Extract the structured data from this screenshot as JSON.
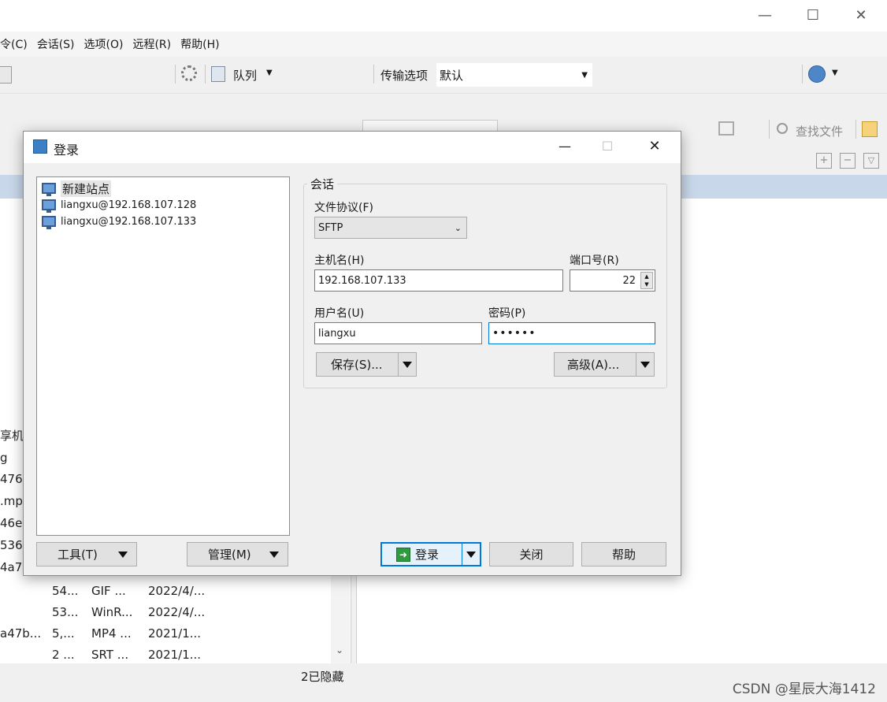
{
  "main": {
    "menu": [
      "令(C)",
      "会话(S)",
      "选项(O)",
      "远程(R)",
      "帮助(H)"
    ],
    "toolbar": {
      "queue_label": "队列",
      "transfer_label": "传输选项",
      "transfer_value": "默认"
    },
    "right_toolbar": {
      "find_files_label": "查找文件"
    },
    "left_cut_texts": [
      "享机",
      "g",
      "476",
      ".mp",
      "46e",
      "536",
      "4a7"
    ],
    "files": [
      {
        "name": "",
        "size": "54...",
        "type": "GIF ...",
        "date": "2022/4/..."
      },
      {
        "name": "",
        "size": "53...",
        "type": "WinR...",
        "date": "2022/4/..."
      },
      {
        "name": "a47b...",
        "size": "5,...",
        "type": "MP4 ...",
        "date": "2021/1..."
      },
      {
        "name": "",
        "size": "2 ...",
        "type": "SRT ...",
        "date": "2021/1..."
      }
    ],
    "status": "2已隐藏",
    "watermark": "CSDN @星辰大海1412"
  },
  "dialog": {
    "title": "登录",
    "sites": [
      {
        "label": "新建站点",
        "icon": "new-site-icon"
      },
      {
        "label": "liangxu@192.168.107.128",
        "icon": "monitor-icon"
      },
      {
        "label": "liangxu@192.168.107.133",
        "icon": "monitor-icon"
      }
    ],
    "session_legend": "会话",
    "protocol_label": "文件协议(F)",
    "protocol_value": "SFTP",
    "host_label": "主机名(H)",
    "host_value": "192.168.107.133",
    "port_label": "端口号(R)",
    "port_value": "22",
    "user_label": "用户名(U)",
    "user_value": "liangxu",
    "password_label": "密码(P)",
    "password_value": "••••••",
    "save_button": "保存(S)...",
    "advanced_button": "高级(A)...",
    "tools_button": "工具(T)",
    "manage_button": "管理(M)",
    "login_button": "登录",
    "close_button": "关闭",
    "help_button": "帮助"
  }
}
